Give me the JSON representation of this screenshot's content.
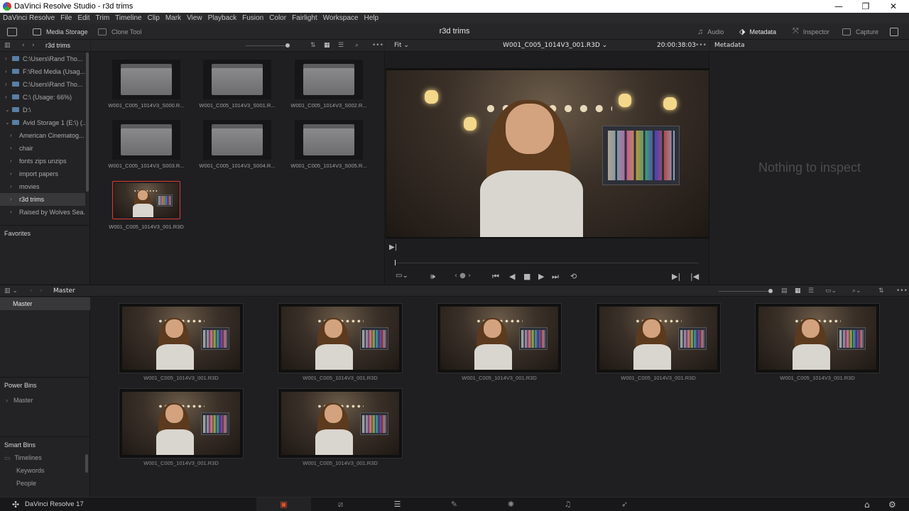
{
  "window": {
    "title": "DaVinci Resolve Studio - r3d trims",
    "controls": [
      "—",
      "❐",
      "✕"
    ]
  },
  "menu": [
    "DaVinci Resolve",
    "File",
    "Edit",
    "Trim",
    "Timeline",
    "Clip",
    "Mark",
    "View",
    "Playback",
    "Fusion",
    "Color",
    "Fairlight",
    "Workspace",
    "Help"
  ],
  "toolbar": {
    "media_storage": "Media Storage",
    "clone_tool": "Clone Tool",
    "page_title": "r3d trims",
    "audio": "Audio",
    "metadata": "Metadata",
    "inspector": "Inspector",
    "capture": "Capture"
  },
  "storage": {
    "path": "r3d trims",
    "tree": [
      {
        "label": "C:\\Users\\Rand Tho...",
        "arrow": "›"
      },
      {
        "label": "F:\\Red Media (Usag...",
        "arrow": "›"
      },
      {
        "label": "C:\\Users\\Rand Tho...",
        "arrow": "›"
      },
      {
        "label": "C:\\ (Usage: 66%)",
        "arrow": "›"
      },
      {
        "label": "D:\\",
        "arrow": "⌄"
      },
      {
        "label": "Avid Storage 1 (E:\\) (...",
        "arrow": "⌄"
      },
      {
        "label": "American Cinematog...",
        "arrow": "›"
      },
      {
        "label": "chair",
        "arrow": "›"
      },
      {
        "label": "fonts zips unzips",
        "arrow": "›"
      },
      {
        "label": "import papers",
        "arrow": "›"
      },
      {
        "label": "movies",
        "arrow": "›"
      },
      {
        "label": "r3d trims",
        "arrow": "›"
      },
      {
        "label": "Raised by Wolves Sea...",
        "arrow": "›"
      }
    ],
    "favorites": "Favorites"
  },
  "browser": {
    "folders": [
      "W001_C005_1014V3_S000.R...",
      "W001_C005_1014V3_S001.R...",
      "W001_C005_1014V3_S002.R...",
      "W001_C005_1014V3_S003.R...",
      "W001_C005_1014V3_S004.R...",
      "W001_C005_1014V3_S005.R..."
    ],
    "selected_clip": "W001_C005_1014V3_001.R3D"
  },
  "viewer": {
    "zoom": "Fit",
    "clip_name": "W001_C005_1014V3_001.R3D",
    "timecode": "20:00:38:03",
    "more": "•••"
  },
  "metadata": {
    "header": "Metadata",
    "empty_text": "Nothing to inspect"
  },
  "pool": {
    "bin_title": "Master",
    "bins": {
      "master": "Master",
      "power_bins": "Power Bins",
      "power_master": "Master",
      "smart_bins": "Smart Bins",
      "smart_items": [
        "Timelines",
        "Keywords",
        "People"
      ]
    },
    "clips": [
      "W001_C005_1014V3_001.R3D",
      "W001_C005_1014V3_001.R3D",
      "W001_C005_1014V3_001.R3D",
      "W001_C005_1014V3_001.R3D",
      "W001_C005_1014V3_001.R3D",
      "W001_C005_1014V3_001.R3D",
      "W001_C005_1014V3_001.R3D"
    ]
  },
  "bottom": {
    "app_name": "DaVinci Resolve 17",
    "pages": [
      "media-page",
      "cut-page",
      "edit-page",
      "fusion-page",
      "color-page",
      "fairlight-page",
      "deliver-page"
    ]
  }
}
